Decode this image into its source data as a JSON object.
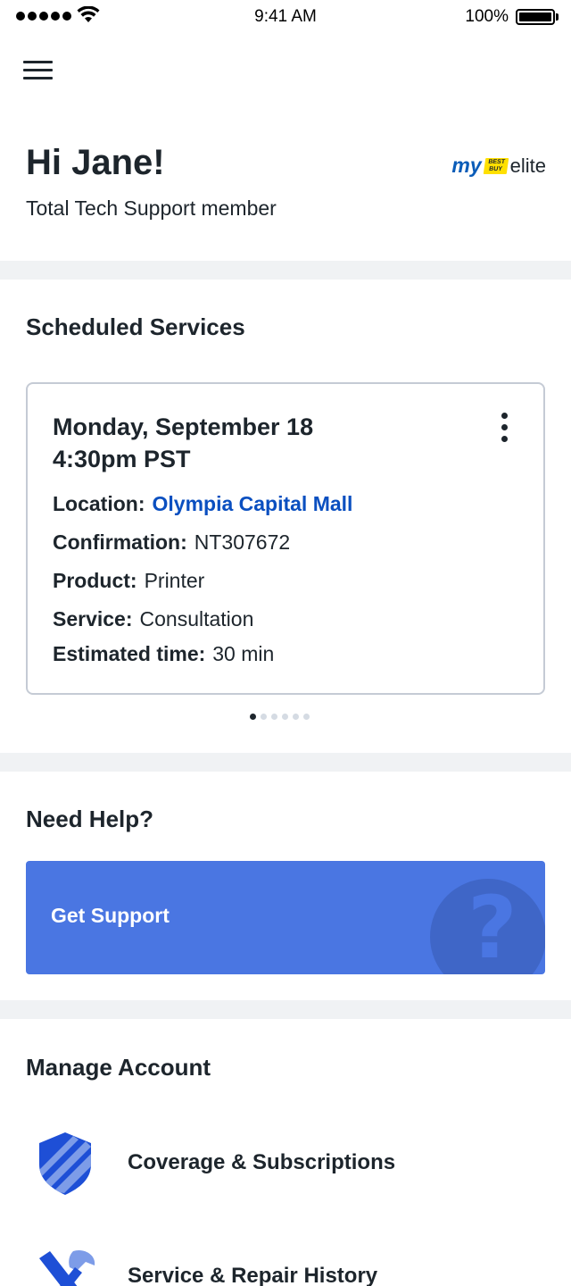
{
  "status_bar": {
    "time": "9:41 AM",
    "battery": "100%"
  },
  "header": {
    "greeting": "Hi Jane!",
    "membership": "Total Tech Support member",
    "logo": {
      "my": "my",
      "tag": "BEST BUY",
      "tier": "elite"
    }
  },
  "scheduled": {
    "title": "Scheduled Services",
    "card": {
      "date": "Monday, September 18",
      "time": "4:30pm PST",
      "rows": [
        {
          "label": "Location:",
          "value": "Olympia Capital Mall"
        },
        {
          "label": "Confirmation:",
          "value": "NT307672"
        },
        {
          "label": "Product:",
          "value": "Printer"
        },
        {
          "label": "Service:",
          "value": "Consultation"
        },
        {
          "label": "Estimated time:",
          "value": "30 min"
        }
      ]
    },
    "pagination": {
      "current": 1,
      "total": 6
    }
  },
  "help": {
    "title": "Need Help?",
    "button": "Get Support",
    "icon": "question-mark-icon"
  },
  "account": {
    "title": "Manage Account",
    "items": [
      {
        "label": "Coverage & Subscriptions",
        "icon": "shield-icon"
      },
      {
        "label": "Service & Repair History",
        "icon": "hammer-wrench-icon"
      }
    ]
  },
  "colors": {
    "accent": "#0a4fc0",
    "banner": "#4a76e2",
    "divider": "#f0f2f4",
    "text": "#1d252c"
  }
}
